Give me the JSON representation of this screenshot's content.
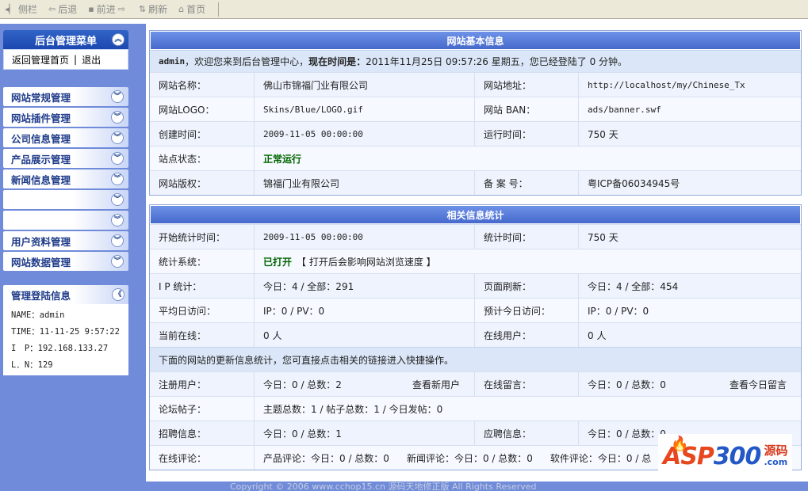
{
  "toolbar": {
    "sidebar_label": "侧栏",
    "back_label": "后退",
    "forward_label": "前进",
    "refresh_label": "刷新",
    "home_label": "首页"
  },
  "sidebar": {
    "menu_title": "后台管理菜单",
    "home_link": "返回管理首页",
    "link_sep": "|",
    "logout_link": "退出",
    "nav_items": [
      {
        "label": "网站常规管理"
      },
      {
        "label": "网站插件管理"
      },
      {
        "label": "公司信息管理"
      },
      {
        "label": "产品展示管理"
      },
      {
        "label": "新闻信息管理"
      },
      {
        "label": ""
      },
      {
        "label": ""
      },
      {
        "label": "用户资料管理"
      },
      {
        "label": "网站数据管理"
      }
    ],
    "login_title": "管理登陆信息",
    "login_name": "NAME：admin",
    "login_time": "TIME：11-11-25 9:57:22",
    "login_ip": "I　P：192.168.133.27",
    "login_ln": "L．N：129"
  },
  "basic": {
    "title": "网站基本信息",
    "welcome_user": "admin",
    "welcome_text": "，欢迎您来到后台管理中心，",
    "welcome_time_label": "现在时间是：",
    "welcome_time": "2011年11月25日 09:57:26 星期五",
    "welcome_tail": "，您已经登陆了 0 分钟。",
    "rows": [
      {
        "l1": "网站名称：",
        "v1": "佛山市锦福门业有限公司",
        "l2": "网站地址：",
        "v2": "http://localhost/my/Chinese_Tx"
      },
      {
        "l1": "网站LOGO：",
        "v1": "Skins/Blue/LOGO.gif",
        "l2": "网站 BAN：",
        "v2": "ads/banner.swf"
      },
      {
        "l1": "创建时间：",
        "v1": "2009-11-05 00:00:00",
        "l2": "运行时间：",
        "v2": "750 天"
      },
      {
        "l1": "站点状态：",
        "v1": "正常运行"
      },
      {
        "l1": "网站版权：",
        "v1": "锦福门业有限公司",
        "l2": "备 案 号：",
        "v2": "粤ICP备06034945号"
      }
    ]
  },
  "stats": {
    "title": "相关信息统计",
    "start_label": "开始统计时间：",
    "start_value": "2009-11-05 00:00:00",
    "duration_label": "统计时间：",
    "duration_value": "750 天",
    "system_label": "统计系统：",
    "system_state": "已打开",
    "system_note": "【 打开后会影响网站浏览速度 】",
    "ip_label": "I P 统计：",
    "ip_value": "今日：4 / 全部：291",
    "refresh_label": "页面刷新：",
    "refresh_value": "今日：4 / 全部：454",
    "avg_label": "平均日访问：",
    "avg_value": "IP：0 / PV：0",
    "predict_label": "预计今日访问：",
    "predict_value": "IP：0 / PV：0",
    "online_label": "当前在线：",
    "online_value": "0 人",
    "online_users_label": "在线用户：",
    "online_users_value": "0 人",
    "update_note": "下面的网站的更新信息统计，您可直接点击相关的链接进入快捷操作。",
    "reg_label": "注册用户：",
    "reg_value": "今日：0 / 总数：2",
    "reg_link": "查看新用户",
    "msg_label": "在线留言：",
    "msg_value": "今日：0 / 总数：0",
    "msg_link": "查看今日留言",
    "forum_label": "论坛帖子：",
    "forum_value": "主题总数：1 / 帖子总数：1 / 今日发帖：0",
    "job_label": "招聘信息：",
    "job_value": "今日：0 / 总数：1",
    "apply_label": "应聘信息：",
    "apply_value": "今日：0 / 总数：0",
    "comment_label": "在线评论：",
    "comment_product": "产品评论：今日：0 / 总数：0",
    "comment_news": "新闻评论：今日：0 / 总数：0",
    "comment_soft": "软件评论：今日：0 / 总"
  },
  "footer": {
    "text": "Copyright © 2006 www.cchop15.cn 源码天地修正版  All Rights Reserved"
  },
  "logo": {
    "part1": "ASP",
    "part2": "300",
    "cn": "源码",
    "com": ".com"
  }
}
